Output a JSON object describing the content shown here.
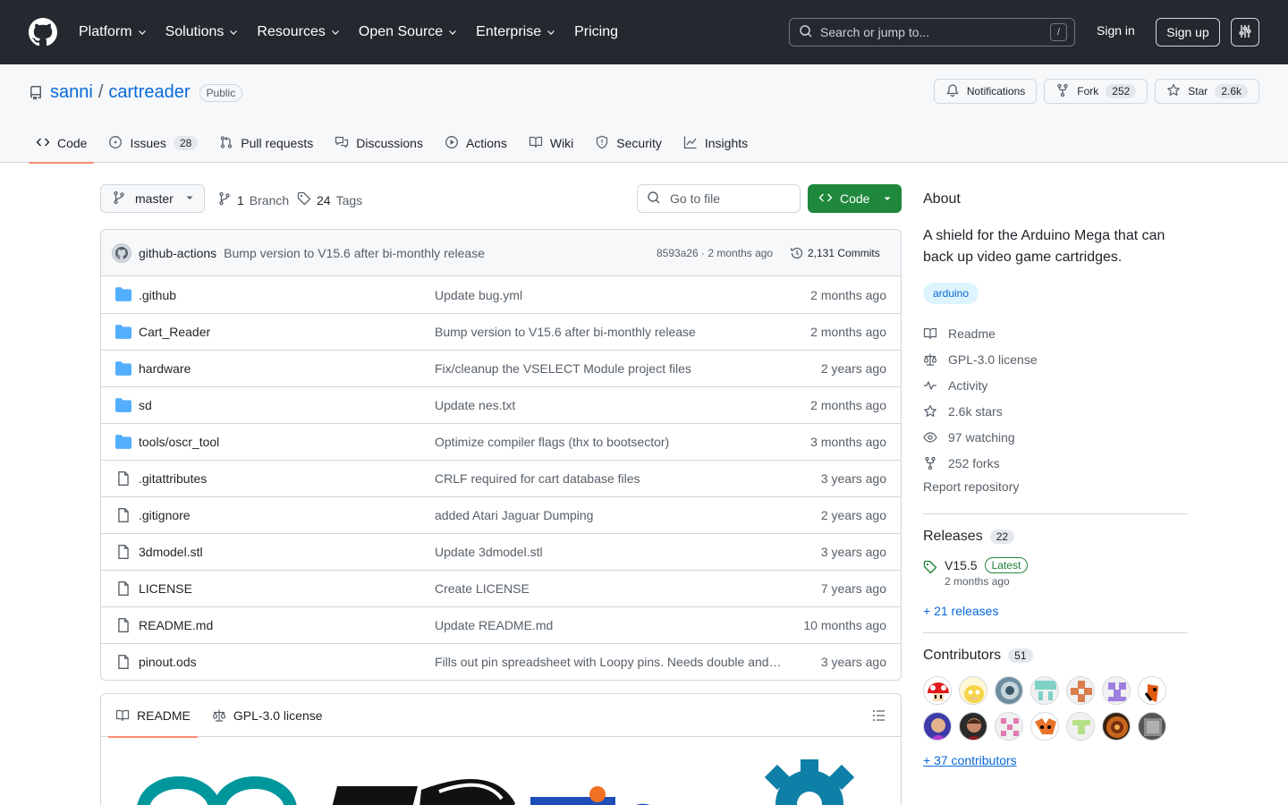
{
  "header": {
    "nav": [
      "Platform",
      "Solutions",
      "Resources",
      "Open Source",
      "Enterprise",
      "Pricing"
    ],
    "search_placeholder": "Search or jump to...",
    "search_shortcut": "/",
    "signin": "Sign in",
    "signup": "Sign up"
  },
  "repo": {
    "owner": "sanni",
    "separator": "/",
    "name": "cartreader",
    "visibility": "Public",
    "notifications": "Notifications",
    "fork_label": "Fork",
    "fork_count": "252",
    "star_label": "Star",
    "star_count": "2.6k",
    "tabs": [
      {
        "label": "Code",
        "count": ""
      },
      {
        "label": "Issues",
        "count": "28"
      },
      {
        "label": "Pull requests",
        "count": ""
      },
      {
        "label": "Discussions",
        "count": ""
      },
      {
        "label": "Actions",
        "count": ""
      },
      {
        "label": "Wiki",
        "count": ""
      },
      {
        "label": "Security",
        "count": ""
      },
      {
        "label": "Insights",
        "count": ""
      }
    ]
  },
  "toolbar": {
    "branch": "master",
    "branch_count": "1",
    "branch_word": "Branch",
    "tag_count": "24",
    "tag_word": "Tags",
    "gofile": "Go to file",
    "code": "Code"
  },
  "commit": {
    "author": "github-actions",
    "message": "Bump version to V15.6 after bi-monthly release",
    "hash_age": "8593a26 · 2 months ago",
    "commits": "2,131 Commits"
  },
  "files": [
    {
      "name": ".github",
      "type": "dir",
      "message": "Update bug.yml",
      "age": "2 months ago"
    },
    {
      "name": "Cart_Reader",
      "type": "dir",
      "message": "Bump version to V15.6 after bi-monthly release",
      "age": "2 months ago"
    },
    {
      "name": "hardware",
      "type": "dir",
      "message": "Fix/cleanup the VSELECT Module project files",
      "age": "2 years ago"
    },
    {
      "name": "sd",
      "type": "dir",
      "message": "Update nes.txt",
      "age": "2 months ago"
    },
    {
      "name": "tools/oscr_tool",
      "type": "dir",
      "message": "Optimize compiler flags (thx to bootsector)",
      "age": "3 months ago"
    },
    {
      "name": ".gitattributes",
      "type": "file",
      "message": "CRLF required for cart database files",
      "age": "3 years ago"
    },
    {
      "name": ".gitignore",
      "type": "file",
      "message": "added Atari Jaguar Dumping",
      "age": "2 years ago"
    },
    {
      "name": "3dmodel.stl",
      "type": "file",
      "message": "Update 3dmodel.stl",
      "age": "3 years ago"
    },
    {
      "name": "LICENSE",
      "type": "file",
      "message": "Create LICENSE",
      "age": "7 years ago"
    },
    {
      "name": "README.md",
      "type": "file",
      "message": "Update README.md",
      "age": "10 months ago"
    },
    {
      "name": "pinout.ods",
      "type": "file",
      "message": "Fills out pin spreadsheet with Loopy pins. Needs double and…",
      "age": "3 years ago"
    }
  ],
  "readme": {
    "tab_readme": "README",
    "tab_license": "GPL-3.0 license"
  },
  "about": {
    "title": "About",
    "description": "A shield for the Arduino Mega that can back up video game cartridges.",
    "topic": "arduino",
    "items": [
      {
        "icon": "book-icon",
        "label": "Readme"
      },
      {
        "icon": "law-icon",
        "label": "GPL-3.0 license"
      },
      {
        "icon": "pulse-icon",
        "label": "Activity"
      },
      {
        "icon": "star-icon",
        "label": "2.6k stars"
      },
      {
        "icon": "eye-icon",
        "label": "97 watching"
      },
      {
        "icon": "fork-icon",
        "label": "252 forks"
      }
    ],
    "report": "Report repository"
  },
  "releases": {
    "title": "Releases",
    "count": "22",
    "latest_name": "V15.5",
    "latest_badge": "Latest",
    "latest_date": "2 months ago",
    "more": "+ 21 releases"
  },
  "contributors": {
    "title": "Contributors",
    "count": "51",
    "more": "+ 37 contributors"
  },
  "colors": {
    "header_bg": "#24292f",
    "accent": "#0969da",
    "green": "#1f883d",
    "tab_underline": "#fd8c73",
    "folder": "#54aeff"
  }
}
